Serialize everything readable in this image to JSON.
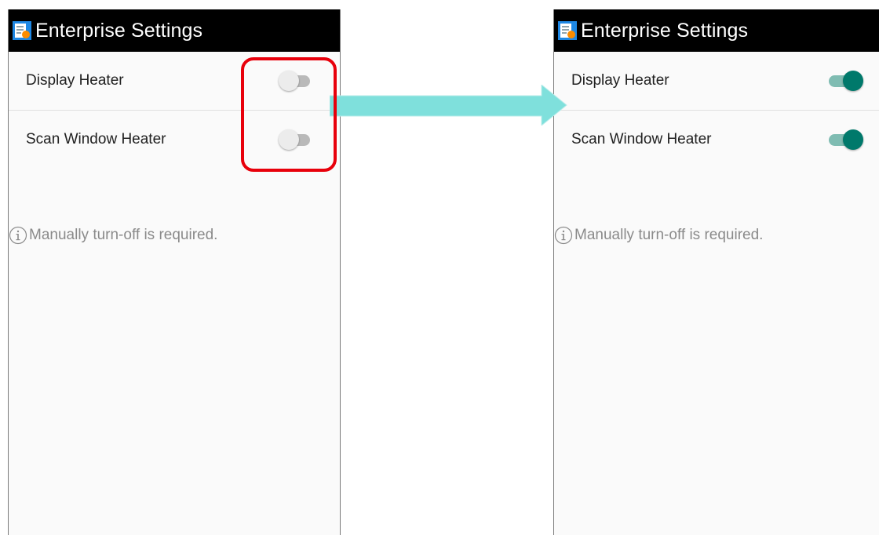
{
  "left_screen": {
    "title": "Enterprise Settings",
    "settings": [
      {
        "label": "Display Heater",
        "state": "off"
      },
      {
        "label": "Scan Window Heater",
        "state": "off"
      }
    ],
    "note": "Manually turn-off is required."
  },
  "right_screen": {
    "title": "Enterprise Settings",
    "settings": [
      {
        "label": "Display Heater",
        "state": "on"
      },
      {
        "label": "Scan Window Heater",
        "state": "on"
      }
    ],
    "note": "Manually turn-off is required."
  },
  "colors": {
    "toggle_on": "#00796b",
    "toggle_off": "#ececec",
    "highlight": "#e8000b",
    "arrow": "#7fe0dc"
  },
  "icons": {
    "app": "enterprise-settings-icon",
    "info": "info-circle-icon",
    "arrow": "right-arrow-icon"
  }
}
